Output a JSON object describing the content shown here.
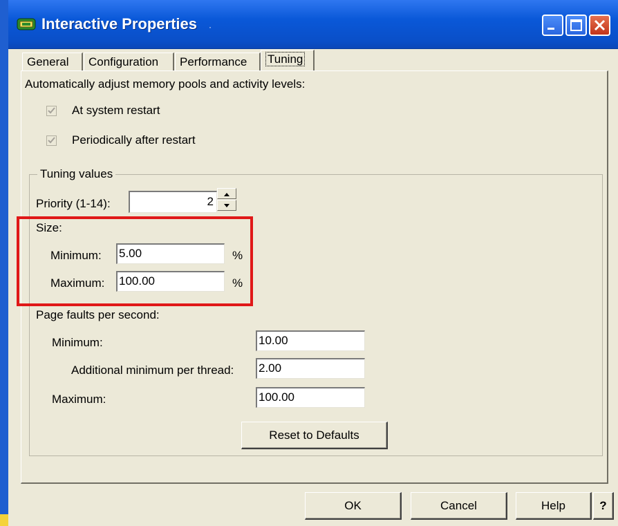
{
  "window": {
    "title": "Interactive Properties"
  },
  "tabs": [
    {
      "label": "General"
    },
    {
      "label": "Configuration"
    },
    {
      "label": "Performance"
    },
    {
      "label": "Tuning",
      "active": true
    }
  ],
  "auto_adjust": {
    "heading": "Automatically adjust memory pools and activity levels:",
    "options": [
      {
        "label": "At system restart",
        "checked": true,
        "disabled": true
      },
      {
        "label": "Periodically after restart",
        "checked": true,
        "disabled": true
      }
    ]
  },
  "tuning_values": {
    "legend": "Tuning values",
    "priority": {
      "label": "Priority (1-14):",
      "value": "2"
    },
    "size": {
      "heading": "Size:",
      "minimum": {
        "label": "Minimum:",
        "value": "5.00",
        "unit": "%"
      },
      "maximum": {
        "label": "Maximum:",
        "value": "100.00",
        "unit": "%"
      }
    },
    "page_faults": {
      "heading": "Page faults per second:",
      "minimum": {
        "label": "Minimum:",
        "value": "10.00"
      },
      "additional": {
        "label": "Additional minimum per thread:",
        "value": "2.00"
      },
      "maximum": {
        "label": "Maximum:",
        "value": "100.00"
      }
    },
    "reset_label": "Reset to Defaults"
  },
  "buttons": {
    "ok": "OK",
    "cancel": "Cancel",
    "help": "Help",
    "whats_this": "?"
  },
  "colors": {
    "titlebar": "#0a58d8",
    "dialog_bg": "#ece9d8",
    "highlight": "#e01818"
  },
  "icons": {
    "title": "app-window-icon",
    "minimize": "minimize-icon",
    "maximize": "maximize-icon",
    "close": "close-icon",
    "spin_up": "arrow-up-icon",
    "spin_down": "arrow-down-icon",
    "check": "checkmark-icon"
  }
}
